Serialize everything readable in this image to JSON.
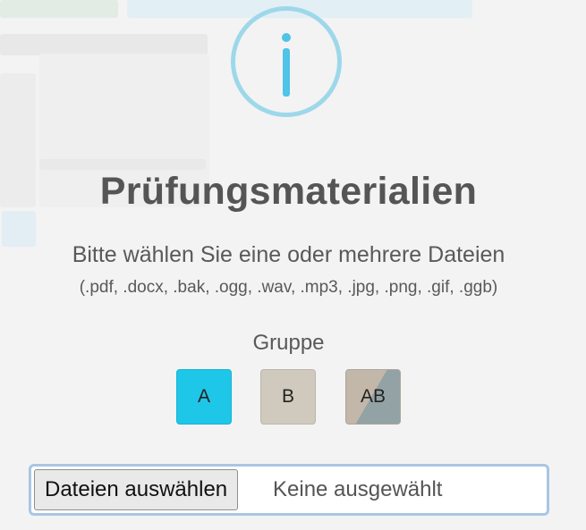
{
  "dialog": {
    "icon": "info-icon",
    "title": "Prüfungsmaterialien",
    "subtitle": "Bitte wählen Sie eine oder mehrere Dateien",
    "extensions": "(.pdf, .docx, .bak, .ogg, .wav, .mp3, .jpg, .png, .gif, .ggb)",
    "group_label": "Gruppe",
    "groups": [
      {
        "label": "A",
        "color": "#1ec6e8"
      },
      {
        "label": "B",
        "color": "#cfcabd"
      },
      {
        "label": "AB",
        "color": "#c2b7a8 / #93a2a5"
      }
    ],
    "file_input": {
      "button_label": "Dateien auswählen",
      "status": "Keine ausgewählt"
    }
  },
  "colors": {
    "accent": "#4fc3e8",
    "focus_border": "#a9c6e3",
    "text": "#555555"
  }
}
